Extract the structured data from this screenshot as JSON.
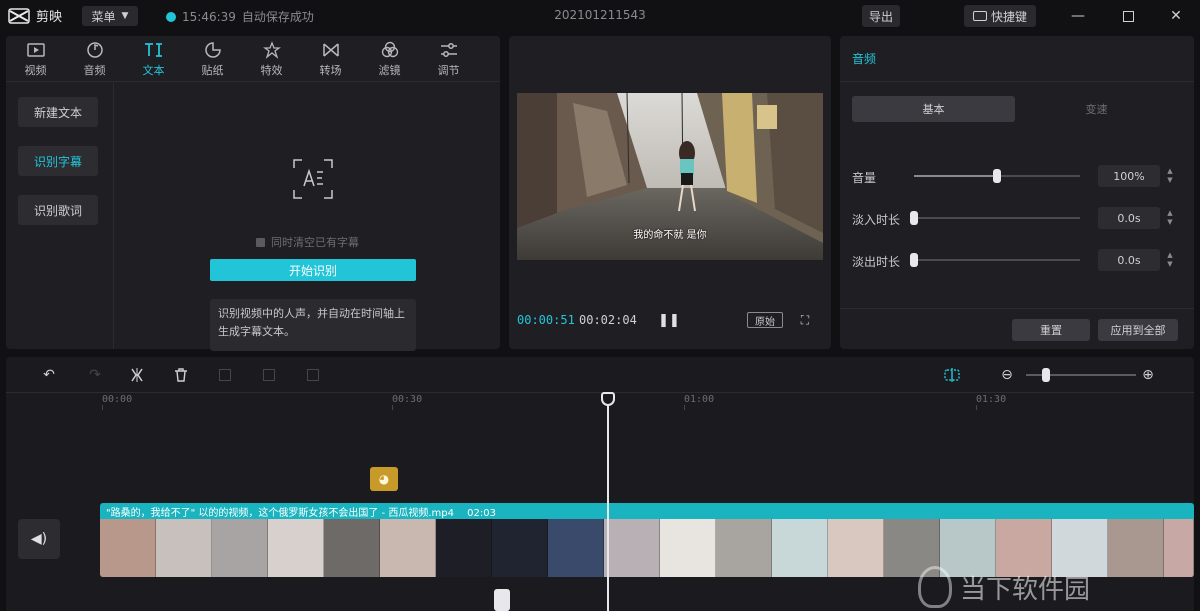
{
  "titlebar": {
    "app_name": "剪映",
    "menu_label": "菜单",
    "save_time": "15:46:39",
    "save_status": "自动保存成功",
    "project_title": "202101211543",
    "export_label": "导出",
    "shortcut_label": "快捷键"
  },
  "tabs": [
    {
      "label": "视频",
      "icon": "video-icon"
    },
    {
      "label": "音频",
      "icon": "audio-icon"
    },
    {
      "label": "文本",
      "icon": "text-icon",
      "active": true
    },
    {
      "label": "贴纸",
      "icon": "sticker-icon"
    },
    {
      "label": "特效",
      "icon": "effects-icon"
    },
    {
      "label": "转场",
      "icon": "transition-icon"
    },
    {
      "label": "滤镜",
      "icon": "filter-icon"
    },
    {
      "label": "调节",
      "icon": "adjust-icon"
    }
  ],
  "sidebar": {
    "items": [
      {
        "label": "新建文本"
      },
      {
        "label": "识别字幕",
        "active": true
      },
      {
        "label": "识别歌词"
      }
    ]
  },
  "recognize": {
    "checkbox_label": "同时清空已有字幕",
    "start_label": "开始识别",
    "tip_line1": "识别视频中的人声，并自动在时间轴上",
    "tip_line2": "生成字幕文本。"
  },
  "preview": {
    "subtitle": "我的命不就 是你",
    "current_time": "00:00:51",
    "total_time": "00:02:04",
    "ratio_label": "原始"
  },
  "props": {
    "title": "音频",
    "seg_basic": "基本",
    "seg_speed": "变速",
    "volume_label": "音量",
    "volume_value": "100%",
    "volume_level": 0.5,
    "fadein_label": "淡入时长",
    "fadein_value": "0.0s",
    "fadeout_label": "淡出时长",
    "fadeout_value": "0.0s",
    "reset_label": "重置",
    "apply_label": "应用到全部"
  },
  "timeline": {
    "ruler": [
      "00:00",
      "00:30",
      "01:00",
      "01:30"
    ],
    "clip_title": "\"路桑的，我给不了\" 以的的视频，这个俄罗斯女孩不会出国了 - 西瓜视频.mp4",
    "clip_duration": "02:03"
  },
  "watermark": "当下软件园",
  "colors": {
    "accent": "#22c5d8",
    "clip": "#19b4bf",
    "sticker": "#c89a2a",
    "panel": "#1f1f23"
  }
}
